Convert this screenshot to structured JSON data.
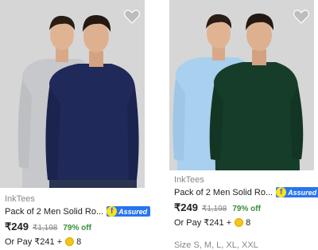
{
  "products": [
    {
      "brand": "InkTees",
      "title": "Pack of 2 Men Solid Ro...",
      "assured_label": "Assured",
      "price": "₹249",
      "mrp": "₹1,198",
      "discount": "79% off",
      "or_pay": "Or Pay ₹241 +",
      "coins": "8",
      "shirt_colors": [
        "#c6c8cc",
        "#1f2a5a"
      ]
    },
    {
      "brand": "InkTees",
      "title": "Pack of 2 Men Solid Ro...",
      "assured_label": "Assured",
      "price": "₹249",
      "mrp": "₹1,198",
      "discount": "79% off",
      "or_pay": "Or Pay ₹241 +",
      "coins": "8",
      "sizes": "Size S, M, L, XL, XXL",
      "shirt_colors": [
        "#a9d0ee",
        "#163d2a"
      ]
    }
  ],
  "colors": {
    "accent": "#2874f0",
    "discount": "#388e3c",
    "muted": "#878787"
  }
}
